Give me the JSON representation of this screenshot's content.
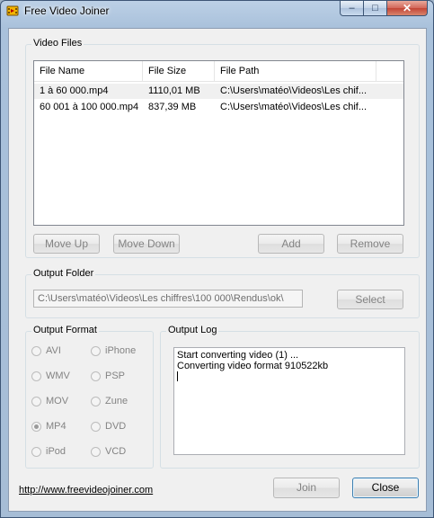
{
  "window": {
    "title": "Free Video Joiner",
    "minimize_glyph": "–",
    "maximize_glyph": "□",
    "close_glyph": "✕"
  },
  "video_files": {
    "group_label": "Video Files",
    "columns": [
      "File Name",
      "File Size",
      "File Path"
    ],
    "rows": [
      {
        "name": "1 à 60 000.mp4",
        "size": "1110,01 MB",
        "path": "C:\\Users\\matéo\\Videos\\Les chif..."
      },
      {
        "name": "60 001 à 100 000.mp4",
        "size": "837,39 MB",
        "path": "C:\\Users\\matéo\\Videos\\Les chif..."
      }
    ],
    "move_up": "Move Up",
    "move_down": "Move Down",
    "add": "Add",
    "remove": "Remove"
  },
  "output_folder": {
    "group_label": "Output Folder",
    "path": "C:\\Users\\matéo\\Videos\\Les chiffres\\100 000\\Rendus\\ok\\",
    "select": "Select"
  },
  "output_format": {
    "group_label": "Output Format",
    "options": [
      "AVI",
      "iPhone",
      "WMV",
      "PSP",
      "MOV",
      "Zune",
      "MP4",
      "DVD",
      "iPod",
      "VCD"
    ],
    "selected": "MP4"
  },
  "output_log": {
    "group_label": "Output Log",
    "lines": [
      "Start converting video (1) ...",
      "Converting video format 910522kb"
    ]
  },
  "footer": {
    "link": "http://www.freevideojoiner.com",
    "join": "Join",
    "close": "Close"
  }
}
